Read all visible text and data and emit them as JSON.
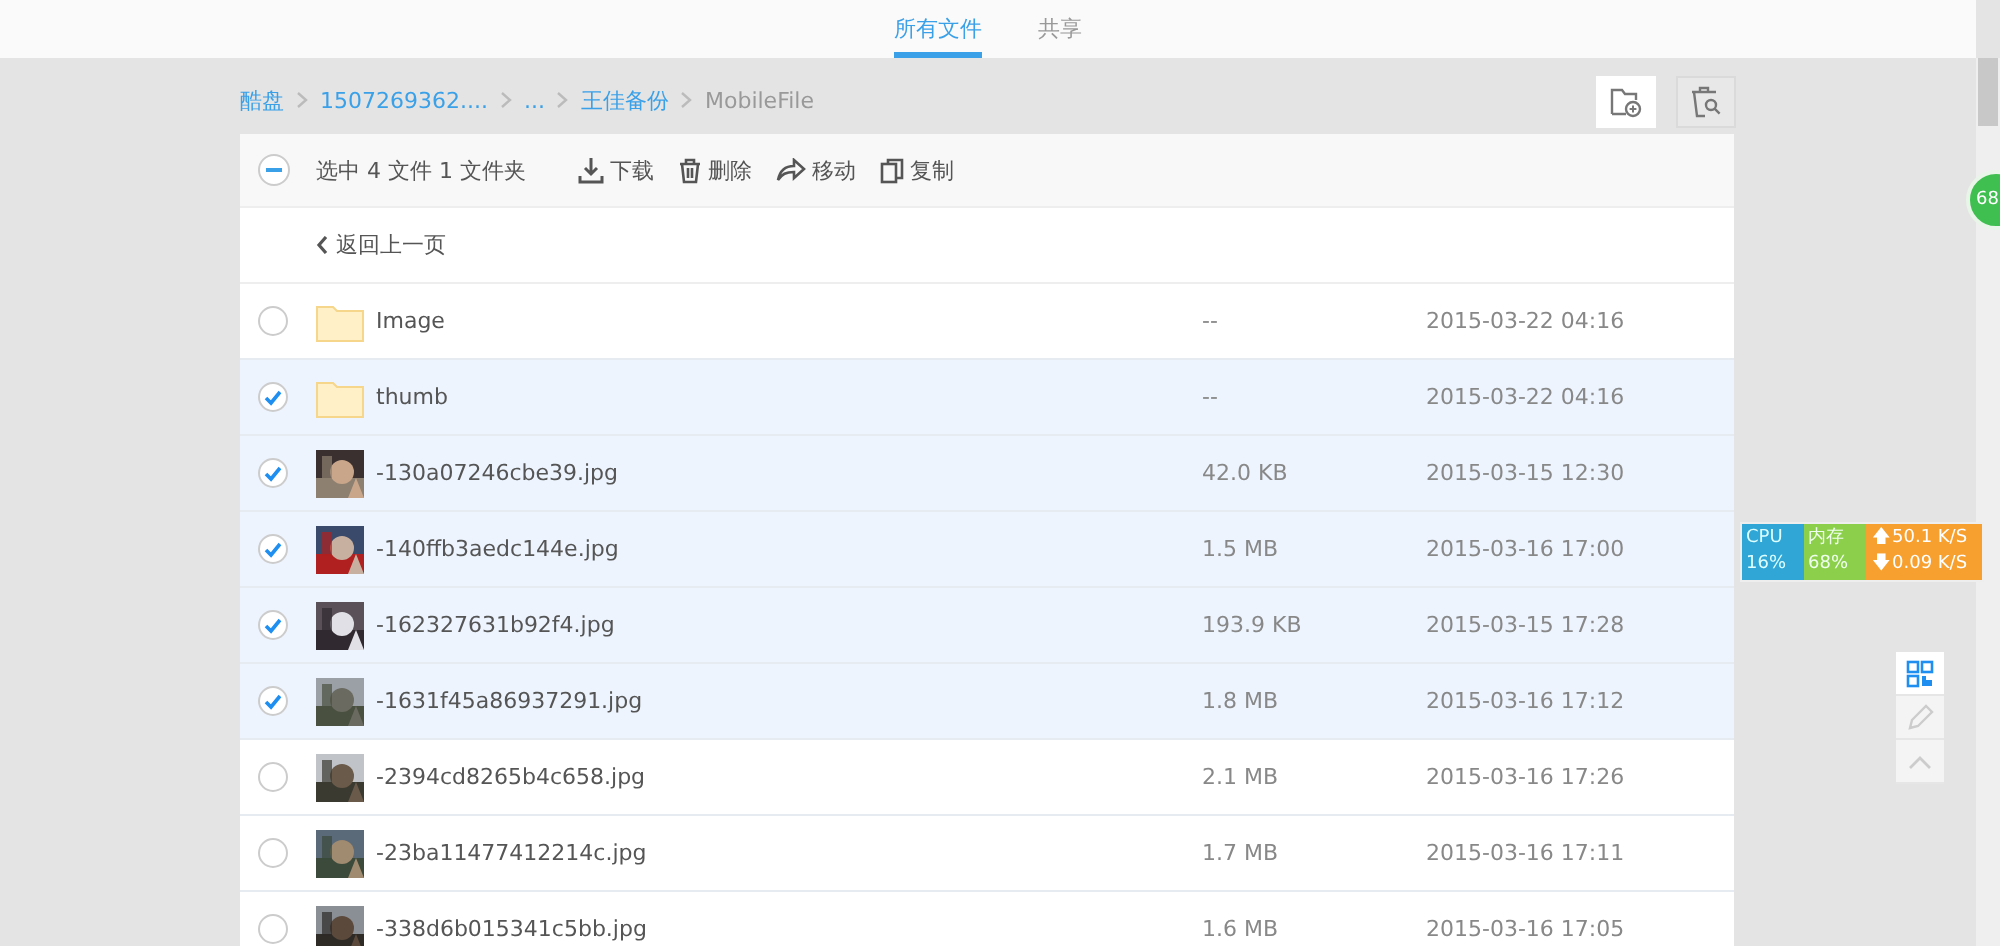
{
  "tabs": [
    {
      "label": "所有文件",
      "selected": true
    },
    {
      "label": "共享",
      "selected": false
    }
  ],
  "breadcrumb": [
    {
      "label": "酷盘"
    },
    {
      "label": "1507269362...."
    },
    {
      "label": "..."
    },
    {
      "label": "王佳备份"
    },
    {
      "label": "MobileFile"
    }
  ],
  "toolbar": {
    "selection_checked": true,
    "selection_text": "选中 4 文件 1 文件夹",
    "actions": [
      {
        "kind": "download",
        "label": "下载"
      },
      {
        "kind": "delete",
        "label": "删除"
      },
      {
        "kind": "move",
        "label": "移动"
      },
      {
        "kind": "copy",
        "label": "复制"
      }
    ]
  },
  "back_link": "返回上一页",
  "files": [
    {
      "kind": "folder",
      "name": "Image",
      "size": "--",
      "date": "2015-03-22 04:16",
      "selected": false
    },
    {
      "kind": "folder",
      "name": "thumb",
      "size": "--",
      "date": "2015-03-22 04:16",
      "selected": true
    },
    {
      "name": "-130a07246cbe39.jpg",
      "size": "42.0 KB",
      "date": "2015-03-15 12:30",
      "selected": true
    },
    {
      "name": "-140ffb3aedc144e.jpg",
      "size": "1.5 MB",
      "date": "2015-03-16 17:00",
      "selected": true
    },
    {
      "name": "-162327631b92f4.jpg",
      "size": "193.9 KB",
      "date": "2015-03-15 17:28",
      "selected": true
    },
    {
      "name": "-1631f45a86937291.jpg",
      "size": "1.8 MB",
      "date": "2015-03-16 17:12",
      "selected": true
    },
    {
      "name": "-2394cd8265b4c658.jpg",
      "size": "2.1 MB",
      "date": "2015-03-16 17:26",
      "selected": false
    },
    {
      "name": "-23ba11477412214c.jpg",
      "size": "1.7 MB",
      "date": "2015-03-16 17:11",
      "selected": false
    },
    {
      "name": "-338d6b015341c5bb.jpg",
      "size": "1.6 MB",
      "date": "2015-03-16 17:05",
      "selected": false
    }
  ],
  "monitor": {
    "cpu_label": "CPU",
    "cpu_value": "16%",
    "mem_label": "内存",
    "mem_value": "68%",
    "upload": "50.1 K/S",
    "download": "0.09 K/S",
    "upload_arrow": "🡅",
    "download_arrow": "🡇"
  },
  "badge": "68"
}
